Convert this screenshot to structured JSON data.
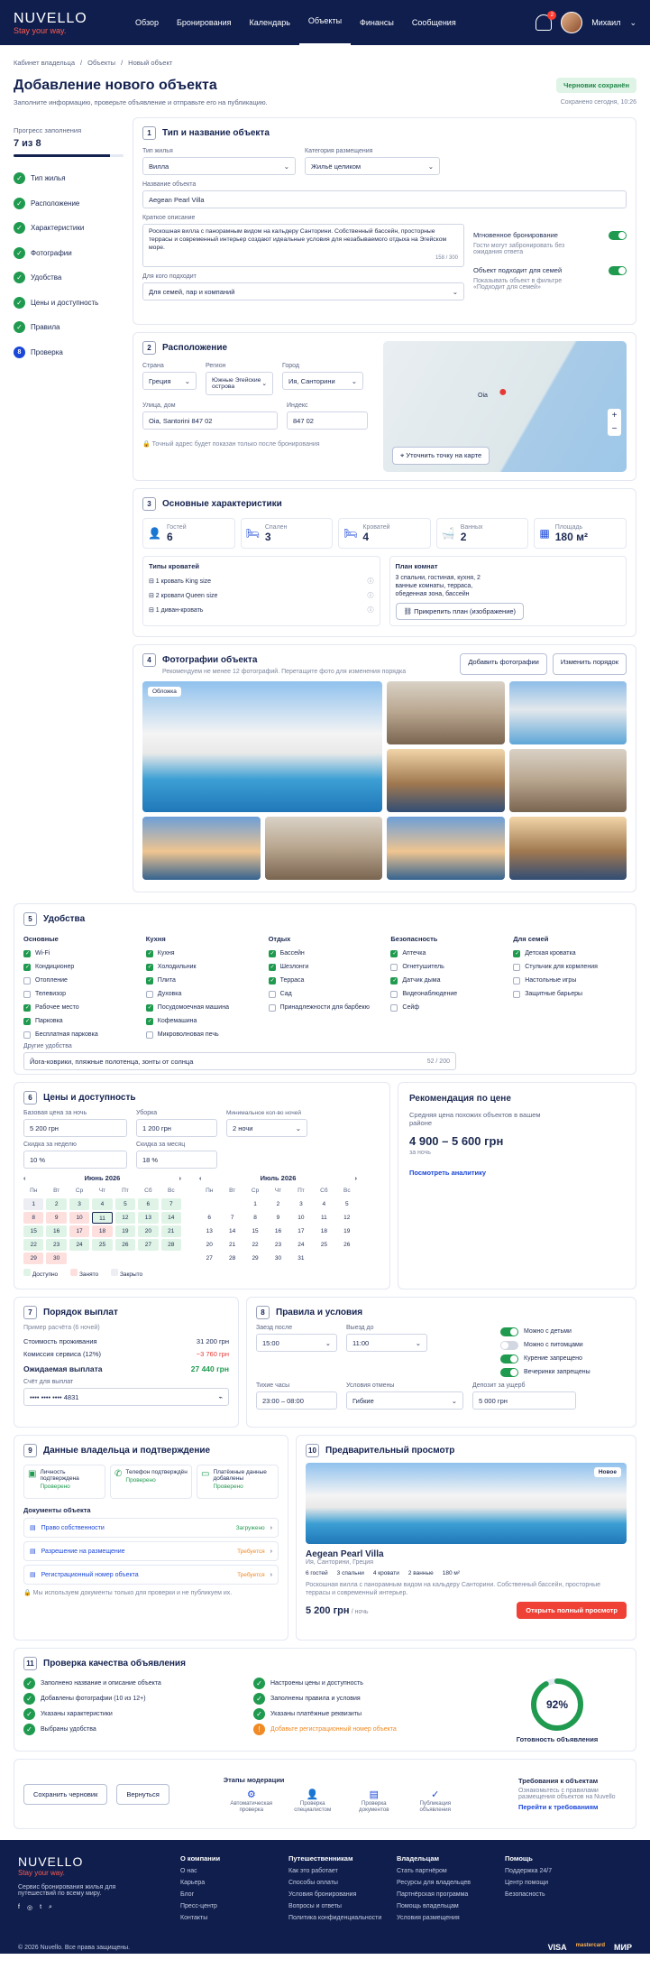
{
  "brand": {
    "name": "NUVELLO",
    "tagline": "Stay your way."
  },
  "nav": {
    "items": [
      "Обзор",
      "Бронирования",
      "Календарь",
      "Объекты",
      "Финансы",
      "Сообщения"
    ],
    "active": "Объекты"
  },
  "user": {
    "name": "Михаил",
    "notifications": "2"
  },
  "breadcrumb": [
    "Кабинет владельца",
    "Объекты",
    "Новый объект"
  ],
  "page": {
    "title": "Добавление нового объекта",
    "subtitle": "Заполните информацию, проверьте объявление и отправьте его на публикацию.",
    "draft_badge": "Черновик сохранён",
    "saved_at": "Сохранено сегодня, 10:26"
  },
  "progress": {
    "label": "Прогресс заполнения",
    "value_text": "7 из 8",
    "completed": 7,
    "total": 8,
    "steps": [
      "Тип жилья",
      "Расположение",
      "Характеристики",
      "Фотографии",
      "Удобства",
      "Цены и доступность",
      "Правила",
      "Проверка"
    ],
    "current_num": "8"
  },
  "s1": {
    "num": "1",
    "title": "Тип и название объекта",
    "type_label": "Тип жилья",
    "type_value": "Вилла",
    "category_label": "Категория размещения",
    "category_value": "Жильё целиком",
    "name_label": "Название объекта",
    "name_value": "Aegean Pearl Villa",
    "desc_label": "Краткое описание",
    "desc_value": "Роскошная вилла с панорамным видом на кальдеру Санторини. Собственный бассейн, просторные террасы и современный интерьер создают идеальные условия для незабываемого отдыха на Эгейском море.",
    "desc_count": "158 / 300",
    "suit_label": "Для кого подходит",
    "suit_value": "Для семей, пар и компаний",
    "instant_label": "Мгновенное бронирование",
    "instant_desc": "Гости могут забронировать без ожидания ответа",
    "family_label": "Объект подходит для семей",
    "family_desc": "Показывать объект в фильтре «Подходит для семей»"
  },
  "s2": {
    "num": "2",
    "title": "Расположение",
    "country_label": "Страна",
    "country_value": "Греция",
    "region_label": "Регион",
    "region_value": "Южные Эгейские острова",
    "city_label": "Город",
    "city_value": "Ия, Санторини",
    "street_label": "Улица, дом",
    "street_value": "Oia, Santorini 847 02",
    "zip_label": "Индекс",
    "zip_value": "847 02",
    "note": "Точный адрес будет показан только после бронирования",
    "map_place": "Oia",
    "map_button": "Уточнить точку на карте"
  },
  "s3": {
    "num": "3",
    "title": "Основные характеристики",
    "stats": [
      {
        "label": "Гостей",
        "value": "6",
        "icon": "guests-icon"
      },
      {
        "label": "Спален",
        "value": "3",
        "icon": "bed-icon"
      },
      {
        "label": "Кроватей",
        "value": "4",
        "icon": "bed-icon"
      },
      {
        "label": "Ванных",
        "value": "2",
        "icon": "bath-icon"
      },
      {
        "label": "Площадь",
        "value": "180 м²",
        "icon": "area-icon"
      }
    ],
    "beds_title": "Типы кроватей",
    "beds": [
      "1 кровать King size",
      "2 кровати Queen size",
      "1 диван-кровать"
    ],
    "plan_title": "План комнат",
    "plan_text": "3 спальни, гостиная, кухня, 2 ванные комнаты, терраса, обеденная зона, бассейн",
    "plan_button": "Прикрепить план (изображение)"
  },
  "s4": {
    "num": "4",
    "title": "Фотографии объекта",
    "subtitle": "Рекомендуем не менее 12 фотографий. Перетащите фото для изменения порядка",
    "add_button": "Добавить фотографии",
    "order_button": "Изменить порядок",
    "cover_label": "Обложка"
  },
  "s5": {
    "num": "5",
    "title": "Удобства",
    "cols": [
      {
        "title": "Основные",
        "items": [
          [
            "Wi-Fi",
            true
          ],
          [
            "Кондиционер",
            true
          ],
          [
            "Отопление",
            false
          ],
          [
            "Телевизор",
            false
          ],
          [
            "Рабочее место",
            true
          ],
          [
            "Парковка",
            true
          ],
          [
            "Бесплатная парковка",
            false
          ]
        ]
      },
      {
        "title": "Кухня",
        "items": [
          [
            "Кухня",
            true
          ],
          [
            "Холодильник",
            true
          ],
          [
            "Плита",
            true
          ],
          [
            "Духовка",
            false
          ],
          [
            "Посудомоечная машина",
            true
          ],
          [
            "Кофемашина",
            true
          ],
          [
            "Микроволновая печь",
            false
          ]
        ]
      },
      {
        "title": "Отдых",
        "items": [
          [
            "Бассейн",
            true
          ],
          [
            "Шезлонги",
            true
          ],
          [
            "Терраса",
            true
          ],
          [
            "Сад",
            false
          ],
          [
            "Принадлежности для барбекю",
            false
          ]
        ]
      },
      {
        "title": "Безопасность",
        "items": [
          [
            "Аптечка",
            true
          ],
          [
            "Огнетушитель",
            false
          ],
          [
            "Датчик дыма",
            true
          ],
          [
            "Видеонаблюдение",
            false
          ],
          [
            "Сейф",
            false
          ]
        ]
      },
      {
        "title": "Для семей",
        "items": [
          [
            "Детская кроватка",
            true
          ],
          [
            "Стульчик для кормления",
            false
          ],
          [
            "Настольные игры",
            false
          ],
          [
            "Защитные барьеры",
            false
          ]
        ]
      }
    ],
    "other_label": "Другие удобства",
    "other_value": "Йога-коврики, пляжные полотенца, зонты от солнца",
    "other_count": "52 / 200"
  },
  "s6": {
    "num": "6",
    "title": "Цены и доступность",
    "base_label": "Базовая цена за ночь",
    "base_value": "5 200 грн",
    "clean_label": "Уборка",
    "clean_value": "1 200 грн",
    "min_label": "Минимальное кол-во ночей",
    "min_value": "2 ночи",
    "week_label": "Скидка за неделю",
    "week_value": "10 %",
    "month_label": "Скидка за месяц",
    "month_value": "18 %",
    "months": [
      "Июнь 2026",
      "Июль 2026"
    ],
    "weekdays": [
      "Пн",
      "Вт",
      "Ср",
      "Чт",
      "Пт",
      "Сб",
      "Вс"
    ],
    "legend": [
      "Доступно",
      "Занято",
      "Закрыто"
    ],
    "rec_title": "Рекомендация по цене",
    "rec_desc": "Средняя цена похожих объектов в вашем районе",
    "rec_value": "4 900 – 5 600 грн",
    "rec_unit": "за ночь",
    "rec_link": "Посмотреть аналитику"
  },
  "s7": {
    "num": "7",
    "title": "Порядок выплат",
    "example": "Пример расчёта (6 ночей)",
    "rows": [
      [
        "Стоимость проживания",
        "31 200 грн"
      ],
      [
        "Комиссия сервиса (12%)",
        "−3 760 грн"
      ]
    ],
    "total_label": "Ожидаемая выплата",
    "total_value": "27 440 грн",
    "acc_label": "Счёт для выплат",
    "acc_value": "•••• •••• •••• 4831"
  },
  "s8": {
    "num": "8",
    "title": "Правила и условия",
    "checkin_label": "Заезд после",
    "checkin_value": "15:00",
    "checkout_label": "Выезд до",
    "checkout_value": "11:00",
    "toggles": [
      [
        "Можно с детьми",
        true
      ],
      [
        "Можно с питомцами",
        false
      ],
      [
        "Курение запрещено",
        true
      ],
      [
        "Вечеринки запрещены",
        true
      ]
    ],
    "quiet_label": "Тихие часы",
    "quiet_value": "23:00 – 08:00",
    "cancel_label": "Условия отмены",
    "cancel_value": "Гибкие",
    "deposit_label": "Депозит за ущерб",
    "deposit_value": "5 000 грн"
  },
  "s9": {
    "num": "9",
    "title": "Данные владельца и подтверждение",
    "verify": [
      [
        "Личность подтверждена",
        "Проверено"
      ],
      [
        "Телефон подтверждён",
        "Проверено"
      ],
      [
        "Платёжные данные добавлены",
        "Проверено"
      ]
    ],
    "docs_title": "Документы объекта",
    "docs": [
      [
        "Право собственности",
        "Загружено",
        "#1f9a4f"
      ],
      [
        "Разрешение на размещение",
        "Требуется",
        "#f08a24"
      ],
      [
        "Регистрационный номер объекта",
        "Требуется",
        "#f08a24"
      ]
    ],
    "note": "Мы используем документы только для проверки и не публикуем их."
  },
  "s10": {
    "num": "10",
    "title": "Предварительный просмотр",
    "badge": "Новое",
    "name": "Aegean Pearl Villa",
    "location": "Ия, Санторини, Греция",
    "facts": [
      "6 гостей",
      "3 спальни",
      "4 кровати",
      "2 ванные",
      "180 м²"
    ],
    "desc": "Роскошная вилла с панорамным видом на кальдеру Санторини. Собственный бассейн, просторные террасы и современный интерьер.",
    "price": "5 200 грн",
    "unit": "/ ночь",
    "button": "Открыть полный просмотр"
  },
  "s11": {
    "num": "11",
    "title": "Проверка качества объявления",
    "left": [
      [
        "Заполнено название и описание объекта",
        true
      ],
      [
        "Добавлены фотографии (10 из 12+)",
        true
      ],
      [
        "Указаны характеристики",
        true
      ],
      [
        "Выбраны удобства",
        true
      ]
    ],
    "right": [
      [
        "Настроены цены и доступность",
        true
      ],
      [
        "Заполнены правила и условия",
        true
      ],
      [
        "Указаны платёжные реквизиты",
        true
      ],
      [
        "Добавьте регистрационный номер объекта",
        false
      ]
    ],
    "score": 92,
    "score_text": "92%",
    "score_label": "Готовность объявления"
  },
  "bottom": {
    "save": "Сохранить черновик",
    "back": "Вернуться",
    "stages_title": "Этапы модерации",
    "stages": [
      "Автоматическая проверка",
      "Проверка специалистом",
      "Проверка документов",
      "Публикация объявления"
    ],
    "req_title": "Требования к объектам",
    "req_text": "Ознакомьтесь с правилами размещения объектов на Nuvello",
    "req_link": "Перейти к требованиям"
  },
  "footer": {
    "desc": "Сервис бронирования жилья для путешествий по всему миру.",
    "cols": [
      {
        "title": "О компании",
        "items": [
          "О нас",
          "Карьера",
          "Блог",
          "Пресс-центр",
          "Контакты"
        ]
      },
      {
        "title": "Путешественникам",
        "items": [
          "Как это работает",
          "Способы оплаты",
          "Условия бронирования",
          "Вопросы и ответы",
          "Политика конфиденциальности"
        ]
      },
      {
        "title": "Владельцам",
        "items": [
          "Стать партнёром",
          "Ресурсы для владельцев",
          "Партнёрская программа",
          "Помощь владельцам",
          "Условия размещения"
        ]
      },
      {
        "title": "Помощь",
        "items": [
          "Поддержка 24/7",
          "Центр помощи",
          "Безопасность"
        ]
      }
    ],
    "copyright": "© 2026 Nuvello. Все права защищены.",
    "payments": [
      "VISA",
      "mastercard",
      "МИР"
    ]
  }
}
